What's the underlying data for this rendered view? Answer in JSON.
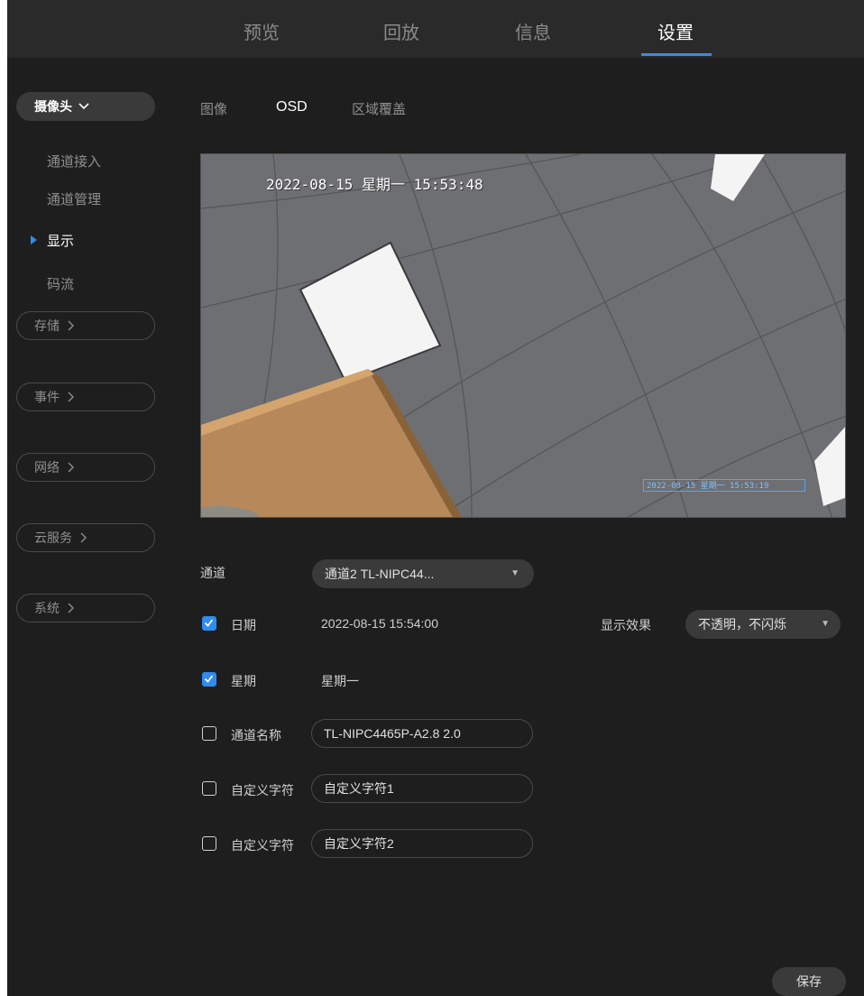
{
  "top_tabs": [
    "预览",
    "回放",
    "信息",
    "设置"
  ],
  "active_top_tab": "设置",
  "sidebar": {
    "camera": {
      "label": "摄像头",
      "items": [
        "通道接入",
        "通道管理",
        "显示",
        "码流"
      ],
      "active_item": "显示"
    },
    "categories": [
      "存储",
      "事件",
      "网络",
      "云服务",
      "系统"
    ]
  },
  "sub_tabs": [
    "图像",
    "OSD",
    "区域覆盖"
  ],
  "active_sub_tab": "OSD",
  "preview": {
    "osd_text": "2022-08-15 星期一 15:53:48",
    "osd_small_text": "2022-08-15 星期一 15:53:19"
  },
  "form": {
    "channel_label": "通道",
    "channel_value": "通道2 TL-NIPC44...",
    "date_label": "日期",
    "date_checked": true,
    "date_value": "2022-08-15 15:54:00",
    "display_effect_label": "显示效果",
    "display_effect_value": "不透明，不闪烁",
    "week_label": "星期",
    "week_checked": true,
    "week_value": "星期一",
    "channel_name_label": "通道名称",
    "channel_name_checked": false,
    "channel_name_value": "TL-NIPC4465P-A2.8 2.0",
    "custom1_label": "自定义字符",
    "custom1_checked": false,
    "custom1_value": "自定义字符1",
    "custom2_label": "自定义字符",
    "custom2_checked": false,
    "custom2_value": "自定义字符2"
  },
  "save_label": "保存",
  "colors": {
    "accent": "#2f8cf0",
    "background": "#1e1e1e",
    "topbar": "#2a2a2a"
  }
}
